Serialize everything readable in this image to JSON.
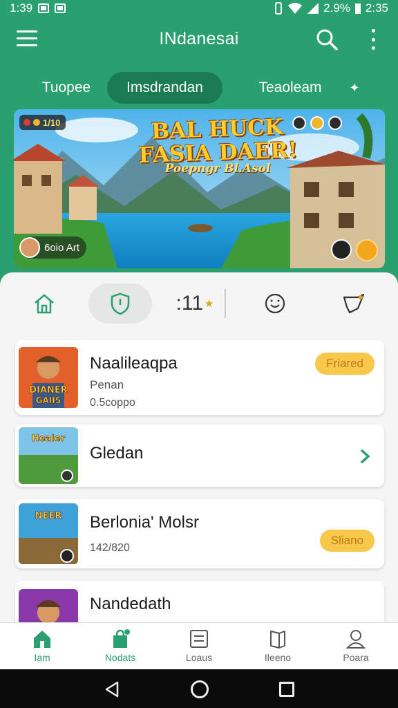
{
  "status_bar": {
    "time": "1:39",
    "battery": "2.9%",
    "clock_right": "2:35"
  },
  "app_bar": {
    "title": "INdanesai"
  },
  "tabs": [
    {
      "label": "Tuopee",
      "active": false
    },
    {
      "label": "Imsdrandan",
      "active": true
    },
    {
      "label": "Teaoleam",
      "active": false
    }
  ],
  "banner": {
    "badge": "1/10",
    "title_line1": "BAL HUCK",
    "title_line2": "FASIA DAER!",
    "subtitle": "Poepngr Bl.Asol",
    "author": "6oio Art"
  },
  "filters": [
    {
      "icon": "home-icon"
    },
    {
      "icon": "shield-icon",
      "active": true
    },
    {
      "label": "11",
      "prefix": ":",
      "icon": "star-icon"
    },
    {
      "icon": "smiley-chat-icon"
    },
    {
      "icon": "tag-icon"
    }
  ],
  "games": [
    {
      "name": "Naalileaqpa",
      "sub": "Penan",
      "meta": "0.5coppo",
      "action": "Friared",
      "thumb_text": "DIANER GAIIS"
    },
    {
      "name": "Gledan",
      "thumb_text": "Healer"
    },
    {
      "name": "Berlonia' Molsr",
      "meta": "142/820",
      "action": "Sliano",
      "thumb_text": "NEER"
    },
    {
      "name": "Nandedath"
    }
  ],
  "bottom_nav": [
    {
      "label": "Iam",
      "icon": "home-icon",
      "active": true
    },
    {
      "label": "Nodats",
      "icon": "bag-icon",
      "active": false
    },
    {
      "label": "Loaus",
      "icon": "list-icon",
      "active": false
    },
    {
      "label": "Ileeno",
      "icon": "book-icon",
      "active": false
    },
    {
      "label": "Poara",
      "icon": "person-icon",
      "active": false
    }
  ],
  "colors": {
    "primary": "#2a9f70",
    "primary_dark": "#1a7a52",
    "pill": "#f7c84a",
    "pill_text": "#c0771a"
  }
}
